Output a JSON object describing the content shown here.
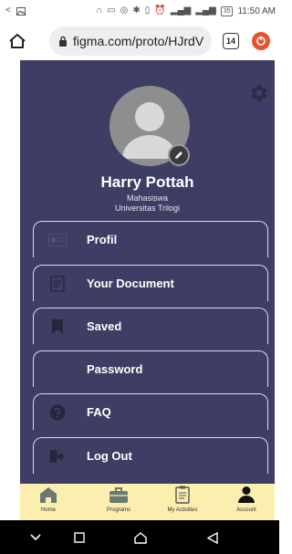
{
  "status_bar": {
    "left_icons": [
      "back-arrow-icon",
      "image-icon"
    ],
    "right_icons": [
      "headphone-icon",
      "message-icon",
      "instagram-icon",
      "bluetooth-icon",
      "vibrate-icon",
      "alarm-icon",
      "signal-icon",
      "signal-icon"
    ],
    "battery": "35",
    "time": "11:50 AM"
  },
  "browser": {
    "url": "figma.com/proto/HJrdV",
    "tab_count": "14"
  },
  "profile": {
    "name": "Harry Pottah",
    "role": "Mahasiswa",
    "university": "Universitas Trilogi"
  },
  "menu": [
    {
      "label": "Profil",
      "icon": "id-card-icon"
    },
    {
      "label": "Your Document",
      "icon": "document-icon"
    },
    {
      "label": "Saved",
      "icon": "bookmark-icon"
    },
    {
      "label": "Password",
      "icon": ""
    },
    {
      "label": "FAQ",
      "icon": "question-icon"
    },
    {
      "label": "Log Out",
      "icon": "logout-icon"
    }
  ],
  "bottom_nav": [
    {
      "label": "Home",
      "icon": "home-icon"
    },
    {
      "label": "Programs",
      "icon": "briefcase-icon"
    },
    {
      "label": "My Activities",
      "icon": "clipboard-icon"
    },
    {
      "label": "Account",
      "icon": "person-icon"
    }
  ],
  "colors": {
    "app_background": "#3e3e64",
    "bottom_nav_background": "#fbeeae",
    "extension_icon": "#e8532e"
  }
}
